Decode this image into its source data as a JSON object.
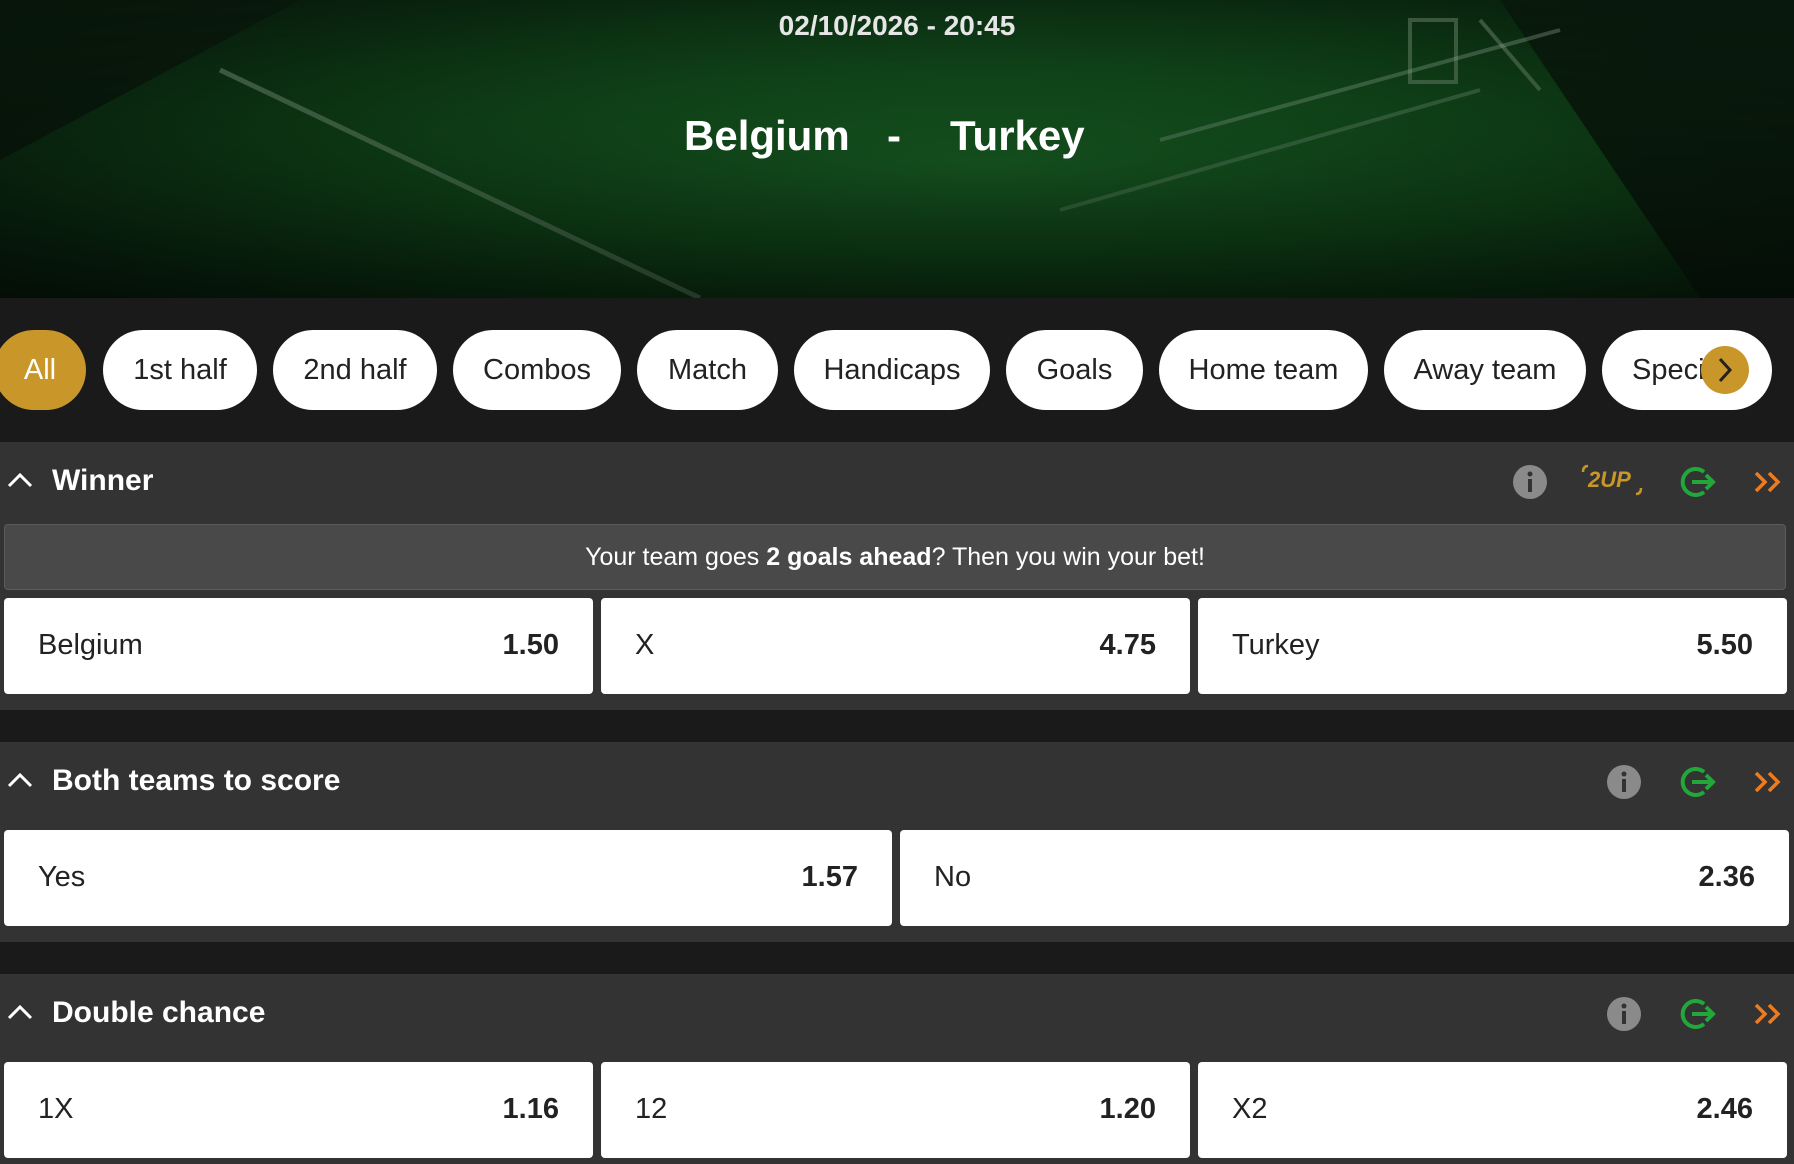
{
  "event": {
    "datetime": "02/10/2026 - 20:45",
    "home_team": "Belgium",
    "separator": "-",
    "away_team": "Turkey"
  },
  "filters": [
    {
      "label": "All",
      "active": true
    },
    {
      "label": "1st half"
    },
    {
      "label": "2nd half"
    },
    {
      "label": "Combos"
    },
    {
      "label": "Match"
    },
    {
      "label": "Handicaps"
    },
    {
      "label": "Goals"
    },
    {
      "label": "Home team"
    },
    {
      "label": "Away team"
    },
    {
      "label": "Speci"
    }
  ],
  "markets": {
    "winner": {
      "title": "Winner",
      "badge": "2UP",
      "promo": {
        "pre": "Your team goes ",
        "bold": "2 goals ahead",
        "post": "? Then you win your bet!"
      },
      "odds": [
        {
          "label": "Belgium",
          "value": "1.50"
        },
        {
          "label": "X",
          "value": "4.75"
        },
        {
          "label": "Turkey",
          "value": "5.50"
        }
      ]
    },
    "btts": {
      "title": "Both teams to score",
      "odds": [
        {
          "label": "Yes",
          "value": "1.57"
        },
        {
          "label": "No",
          "value": "2.36"
        }
      ]
    },
    "double_chance": {
      "title": "Double chance",
      "odds": [
        {
          "label": "1X",
          "value": "1.16"
        },
        {
          "label": "12",
          "value": "1.20"
        },
        {
          "label": "X2",
          "value": "2.46"
        }
      ]
    }
  },
  "colors": {
    "accent": "#c9962a",
    "cashout": "#22a83a",
    "more": "#f07b1c",
    "info": "#8a8a8a"
  }
}
